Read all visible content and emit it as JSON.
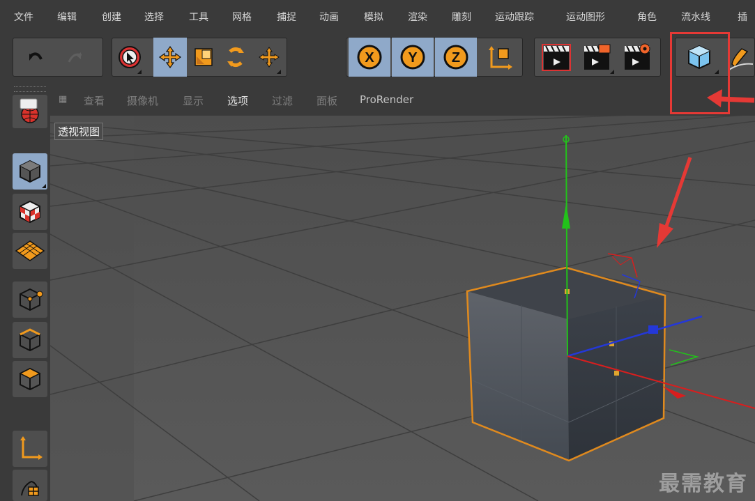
{
  "menu": {
    "items": [
      "文件",
      "编辑",
      "创建",
      "选择",
      "工具",
      "网格",
      "捕捉",
      "动画",
      "模拟",
      "渲染",
      "雕刻",
      "运动跟踪",
      "运动图形",
      "角色",
      "流水线",
      "插"
    ]
  },
  "toolbar": {
    "axis_x": "X",
    "axis_y": "Y",
    "axis_z": "Z",
    "icons": [
      "undo-icon",
      "redo-icon",
      "select-cursor-icon",
      "move-icon",
      "scale-icon",
      "rotate-icon",
      "move-recent-icon",
      "axis-x-icon",
      "axis-y-icon",
      "axis-z-icon",
      "coordinate-system-icon",
      "render-region-icon",
      "render-view-icon",
      "render-settings-icon",
      "cube-icon",
      "pen-icon"
    ]
  },
  "viewport_menu": {
    "items": [
      "查看",
      "摄像机",
      "显示",
      "选项",
      "过滤",
      "面板",
      "ProRender"
    ],
    "active": "选项"
  },
  "viewport": {
    "label": "透视视图"
  },
  "watermark": "最需教育",
  "colors": {
    "menu_bg": "#3a3a3a",
    "viewport_bg": "#545454",
    "active_tool": "#8fa9c9",
    "selection_outline": "#e08a1e",
    "annotation_red": "#e53935",
    "axis_x": "#d81e1e",
    "axis_y": "#22c21a",
    "axis_z": "#2438d8"
  }
}
